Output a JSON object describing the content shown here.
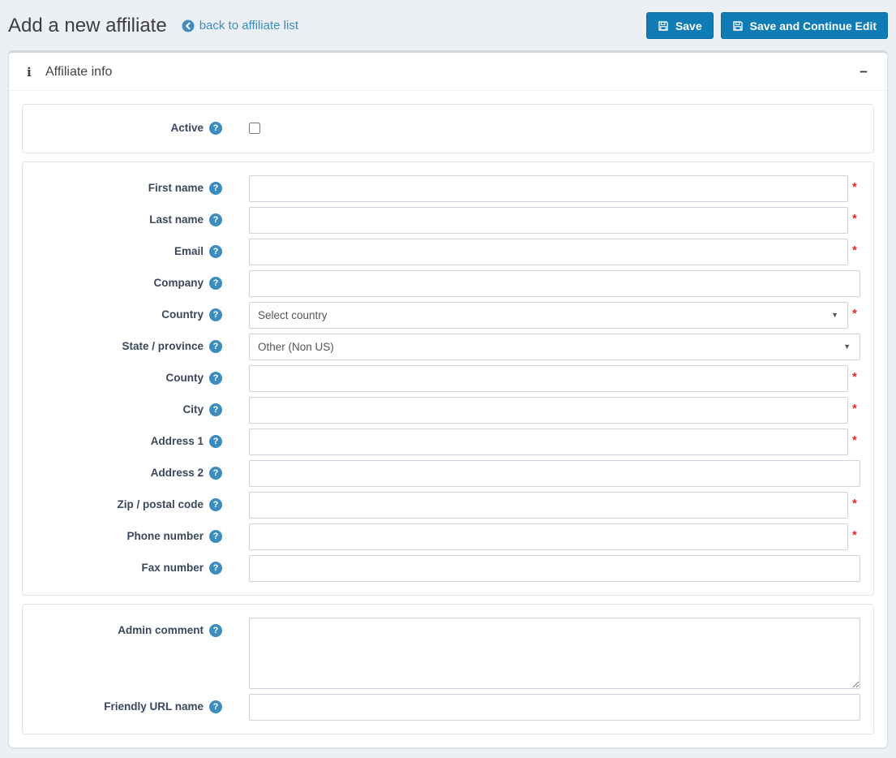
{
  "page": {
    "title": "Add a new affiliate",
    "back_link": "back to affiliate list"
  },
  "toolbar": {
    "save_label": "Save",
    "save_continue_label": "Save and Continue Edit"
  },
  "panel": {
    "title": "Affiliate info"
  },
  "form": {
    "required_marker": "*",
    "fields": {
      "active": {
        "label": "Active",
        "type": "checkbox",
        "checked": false
      },
      "first_name": {
        "label": "First name",
        "type": "text",
        "required": true,
        "value": ""
      },
      "last_name": {
        "label": "Last name",
        "type": "text",
        "required": true,
        "value": ""
      },
      "email": {
        "label": "Email",
        "type": "text",
        "required": true,
        "value": ""
      },
      "company": {
        "label": "Company",
        "type": "text",
        "required": false,
        "value": ""
      },
      "country": {
        "label": "Country",
        "type": "select",
        "required": true,
        "value": "Select country"
      },
      "state_province": {
        "label": "State / province",
        "type": "select",
        "required": false,
        "value": "Other (Non US)"
      },
      "county": {
        "label": "County",
        "type": "text",
        "required": true,
        "value": ""
      },
      "city": {
        "label": "City",
        "type": "text",
        "required": true,
        "value": ""
      },
      "address1": {
        "label": "Address 1",
        "type": "text",
        "required": true,
        "value": ""
      },
      "address2": {
        "label": "Address 2",
        "type": "text",
        "required": false,
        "value": ""
      },
      "zip_postal_code": {
        "label": "Zip / postal code",
        "type": "text",
        "required": true,
        "value": ""
      },
      "phone_number": {
        "label": "Phone number",
        "type": "text",
        "required": true,
        "value": ""
      },
      "fax_number": {
        "label": "Fax number",
        "type": "text",
        "required": false,
        "value": ""
      },
      "admin_comment": {
        "label": "Admin comment",
        "type": "textarea",
        "value": ""
      },
      "friendly_url_name": {
        "label": "Friendly URL name",
        "type": "text",
        "required": false,
        "value": ""
      }
    }
  },
  "icons": {
    "info": "i",
    "help": "?",
    "collapse_minus": "−",
    "dropdown_caret": "▼"
  },
  "colors": {
    "primary_button": "#0f7cb5",
    "link": "#3c8dbc",
    "help_icon": "#3c8dbc",
    "required": "#e02b2b",
    "page_background": "#ecf0f5",
    "card_top_border": "#d2d6de"
  }
}
